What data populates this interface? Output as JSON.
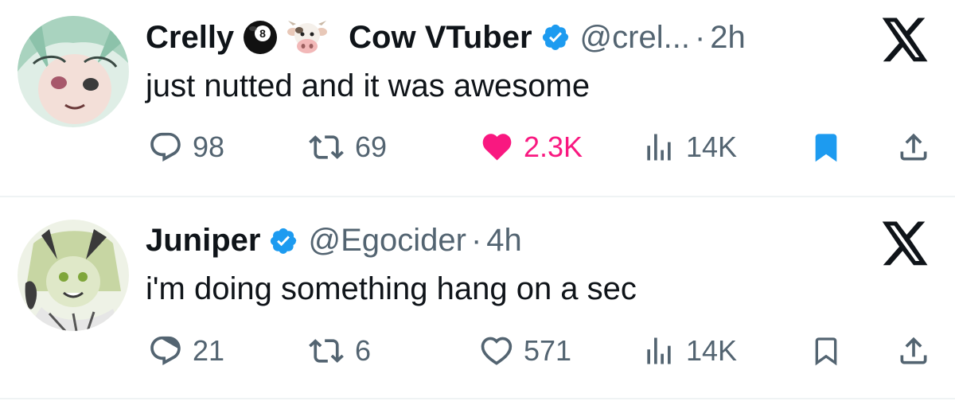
{
  "tweets": [
    {
      "display_name": "Crelly",
      "emojis": [
        "8-ball-icon",
        "cow-face-icon"
      ],
      "name_suffix": "Cow VTuber",
      "verified": true,
      "handle": "@crel...",
      "separator": "·",
      "time": "2h",
      "text": "just nutted and it was awesome",
      "reply_count": "98",
      "retweet_count": "69",
      "like_count": "2.3K",
      "liked": true,
      "view_count": "14K",
      "bookmarked": true
    },
    {
      "display_name": "Juniper",
      "verified": true,
      "handle": "@Egocider",
      "separator": "·",
      "time": "4h",
      "text": "i'm doing something hang on a sec",
      "reply_count": "21",
      "retweet_count": "6",
      "like_count": "571",
      "liked": false,
      "view_count": "14K",
      "bookmarked": false
    }
  ],
  "colors": {
    "text": "#0f1419",
    "secondary": "#536471",
    "verified": "#1d9bf0",
    "like": "#f91880",
    "bookmark": "#1d9bf0",
    "separator": "#eff3f4"
  }
}
